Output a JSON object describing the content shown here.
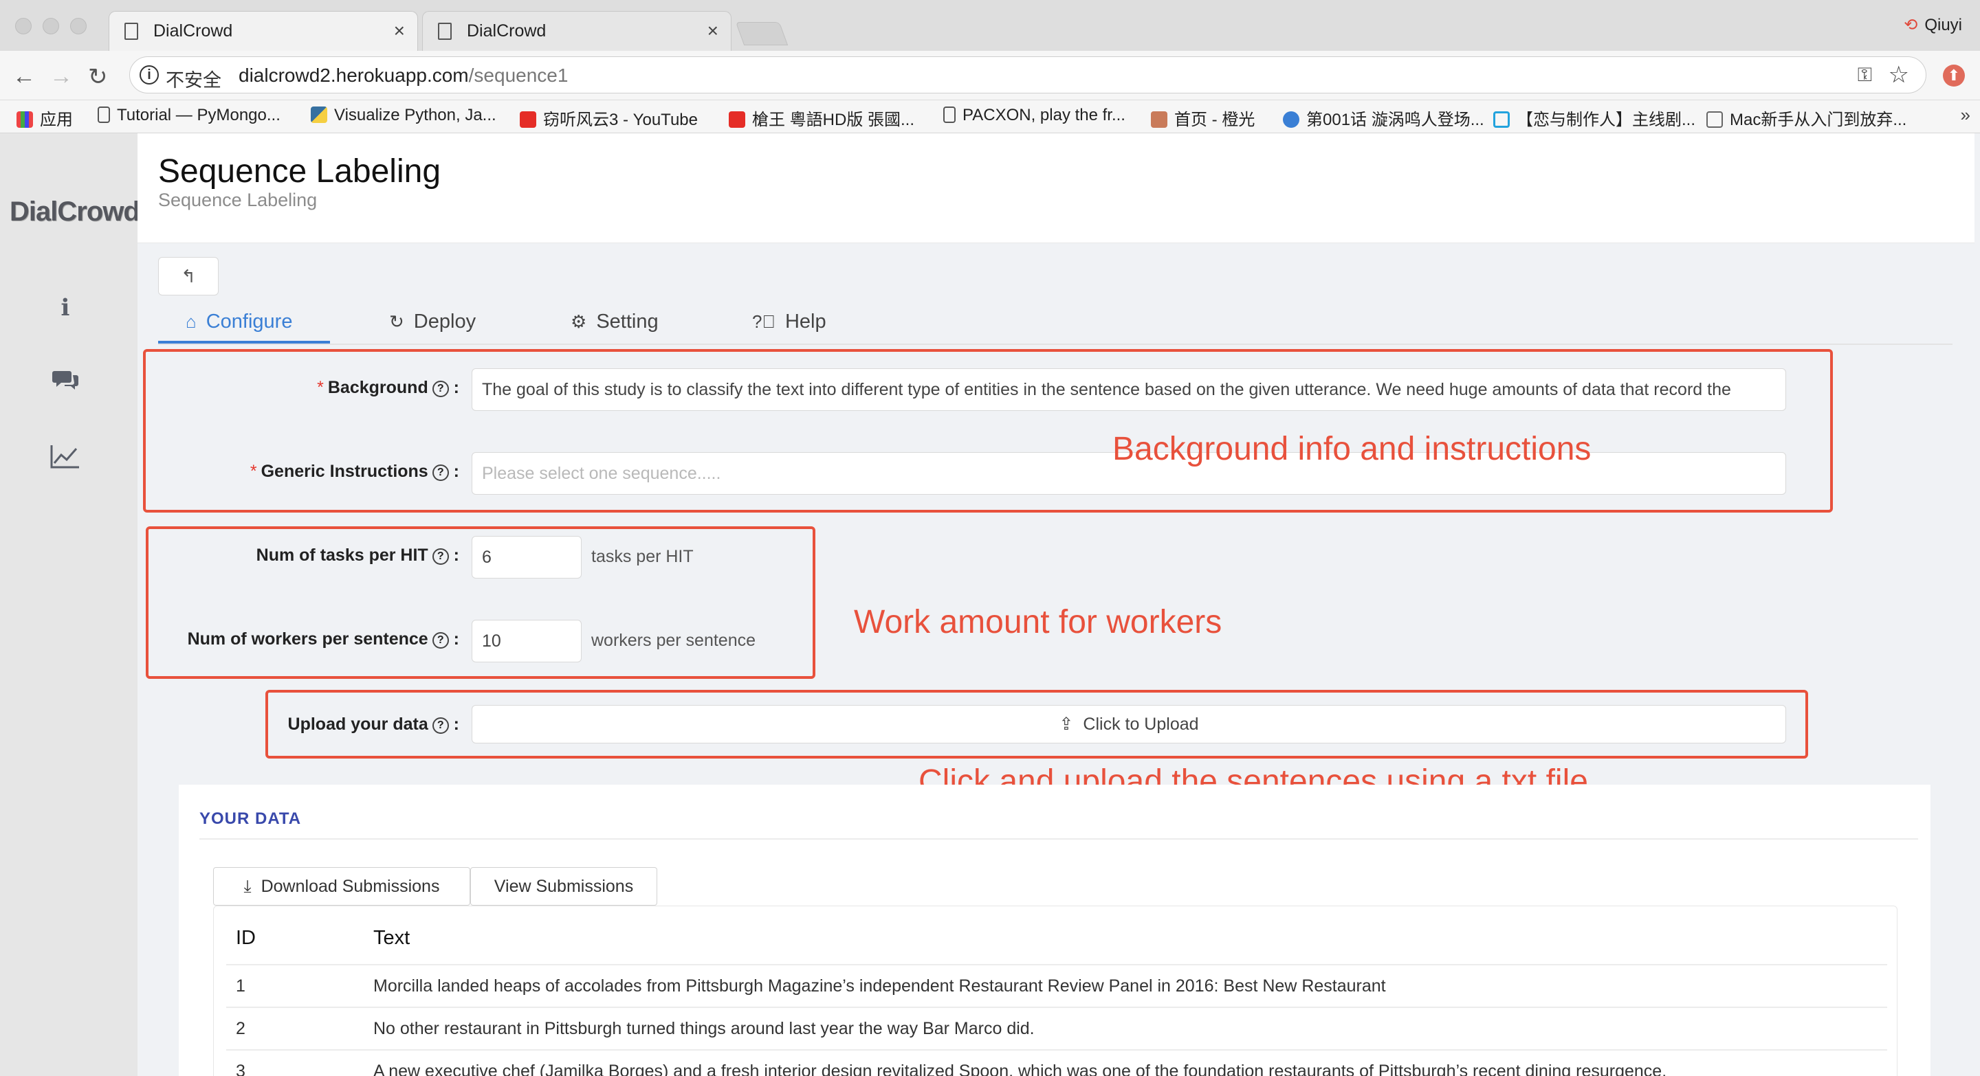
{
  "browser": {
    "tabs": [
      {
        "title": "DialCrowd"
      },
      {
        "title": "DialCrowd"
      }
    ],
    "profile_name": "Qiuyi",
    "security_label": "不安全",
    "url_host": "dialcrowd2.herokuapp.com",
    "url_path": "/sequence1",
    "bookmarks": [
      {
        "label": "应用",
        "icon": "apps-icon"
      },
      {
        "label": "Tutorial — PyMongo...",
        "icon": "page-icon"
      },
      {
        "label": "Visualize Python, Ja...",
        "icon": "python-icon"
      },
      {
        "label": "窃听风云3 - YouTube",
        "icon": "youtube-icon"
      },
      {
        "label": "槍王 粵語HD版 張國...",
        "icon": "youtube-icon"
      },
      {
        "label": "PACXON, play the fr...",
        "icon": "page-icon"
      },
      {
        "label": "首页 - 橙光",
        "icon": "site-icon"
      },
      {
        "label": "第001话 漩涡鸣人登场...",
        "icon": "video-icon"
      },
      {
        "label": "【恋与制作人】主线剧...",
        "icon": "bilibili-icon"
      },
      {
        "label": "Mac新手从入门到放弃...",
        "icon": "site-icon"
      }
    ],
    "bookmarks_more": "»"
  },
  "app": {
    "logo": "DialCrowd",
    "page_title": "Sequence Labeling",
    "page_subtitle": "Sequence Labeling",
    "back_icon": "↰",
    "tabs": [
      {
        "label": "Configure",
        "icon": "home-icon"
      },
      {
        "label": "Deploy",
        "icon": "refresh-icon"
      },
      {
        "label": "Setting",
        "icon": "gear-icon"
      },
      {
        "label": "Help",
        "icon": "question-icon"
      }
    ],
    "form": {
      "background_label": "Background",
      "background_value": "The goal of this study is to classify the text into different type of entities in the sentence based on the given utterance. We need huge amounts of data that record the",
      "instructions_label": "Generic Instructions",
      "instructions_placeholder": "Please select one sequence.....",
      "tasks_label": "Num of tasks per HIT",
      "tasks_value": "6",
      "tasks_suffix": "tasks per HIT",
      "workers_label": "Num of workers per sentence",
      "workers_value": "10",
      "workers_suffix": "workers per sentence",
      "upload_label": "Upload your data",
      "upload_button": "Click to Upload"
    },
    "annotations": {
      "background": "Background info and instructions",
      "work": "Work amount for workers",
      "upload": "Click and upload the sentences using a txt file"
    },
    "data": {
      "section_title": "YOUR DATA",
      "download_button": "Download Submissions",
      "view_button": "View Submissions",
      "columns": [
        "ID",
        "Text"
      ],
      "rows": [
        {
          "id": "1",
          "text": "Morcilla landed heaps of accolades from Pittsburgh Magazine’s independent Restaurant Review Panel in 2016: Best New Restaurant"
        },
        {
          "id": "2",
          "text": "No other restaurant in Pittsburgh turned things around last year the way Bar Marco did."
        },
        {
          "id": "3",
          "text": "A new executive chef (Jamilka Borges) and a fresh interior design revitalized Spoon, which was one of the foundation restaurants of Pittsburgh’s recent dining resurgence."
        }
      ]
    }
  },
  "colors": {
    "accent": "#3a7fd5",
    "annotation": "#e8513c",
    "required": "#e5382e",
    "section_title": "#3949ab"
  }
}
